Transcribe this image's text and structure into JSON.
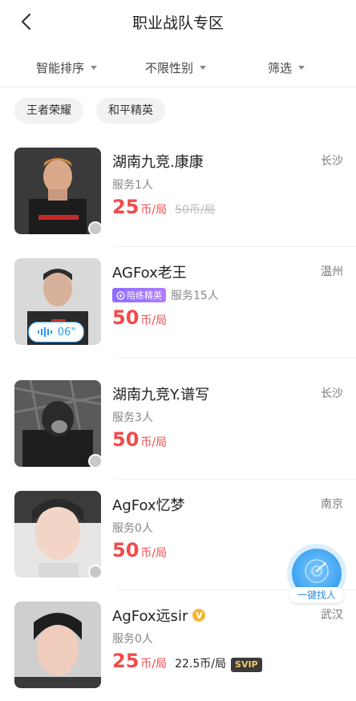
{
  "header": {
    "title": "职业战队专区"
  },
  "filters": [
    {
      "label": "智能排序"
    },
    {
      "label": "不限性别"
    },
    {
      "label": "筛选"
    }
  ],
  "tags": [
    {
      "label": "王者荣耀"
    },
    {
      "label": "和平精英"
    }
  ],
  "players": [
    {
      "name": "湖南九竞.康康",
      "city": "长沙",
      "service": "服务1人",
      "price": "25",
      "unit": "币/局",
      "old_price": "50币/局"
    },
    {
      "name": "AGFox老王",
      "city": "温州",
      "badge": "陪练精英",
      "service": "服务15人",
      "price": "50",
      "unit": "币/局",
      "voice": "06\""
    },
    {
      "name": "湖南九竞Y.谱写",
      "city": "长沙",
      "service": "服务3人",
      "price": "50",
      "unit": "币/局"
    },
    {
      "name": "AgFox忆梦",
      "city": "南京",
      "service": "服务0人",
      "price": "50",
      "unit": "币/局"
    },
    {
      "name": "AgFox远sir",
      "city": "武汉",
      "service": "服务0人",
      "price": "25",
      "unit": "币/局",
      "svip_price": "22.5币/局",
      "svip_label": "SVIP"
    }
  ],
  "fab": {
    "label": "一键找人"
  },
  "colors": {
    "accent": "#f04b4b",
    "blue": "#2d9bf0",
    "badge": "#8a6cff"
  }
}
